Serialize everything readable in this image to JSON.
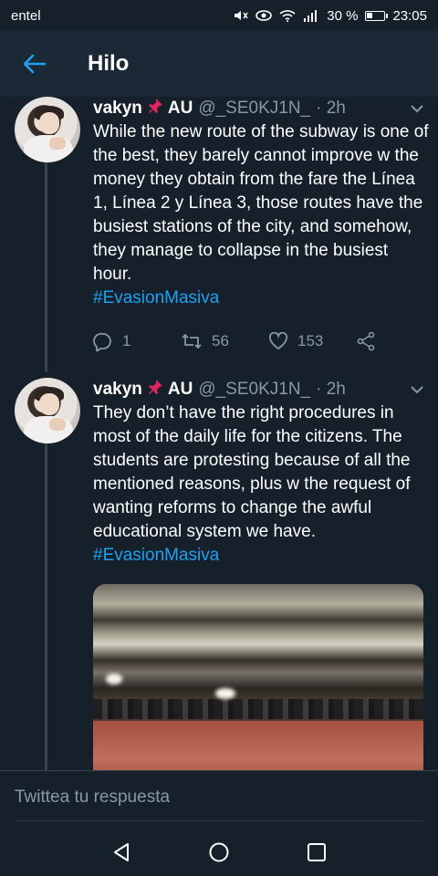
{
  "status_bar": {
    "carrier": "entel",
    "battery_percent": "30 %",
    "time": "23:05"
  },
  "header": {
    "title": "Hilo",
    "back_icon": "arrow-left-icon"
  },
  "tweets": [
    {
      "name": "vakyn",
      "name_suffix": "AU",
      "handle": "@_SE0KJ1N_",
      "time": "· 2h",
      "text": "While the new route of the subway is one of the best, they barely cannot improve w the money they obtain from the fare the Línea 1, Línea 2 y Línea 3, those routes have the busiest stations of the city, and somehow, they manage to collapse in the busiest hour.",
      "hashtag": "#EvasionMasiva",
      "replies": "1",
      "retweets": "56",
      "likes": "153"
    },
    {
      "name": "vakyn",
      "name_suffix": "AU",
      "handle": "@_SE0KJ1N_",
      "time": "· 2h",
      "text": "They don’t have the right procedures in most of the daily life for the citizens. The students are protesting because of all the mentioned reasons, plus w the request of wanting reforms to change the awful educational system we have.",
      "hashtag": "#EvasionMasiva"
    }
  ],
  "reply_bar": {
    "placeholder": "Twittea tu respuesta"
  },
  "colors": {
    "background": "#15202b",
    "accent": "#1da1f2",
    "secondary_text": "#8899a6"
  }
}
